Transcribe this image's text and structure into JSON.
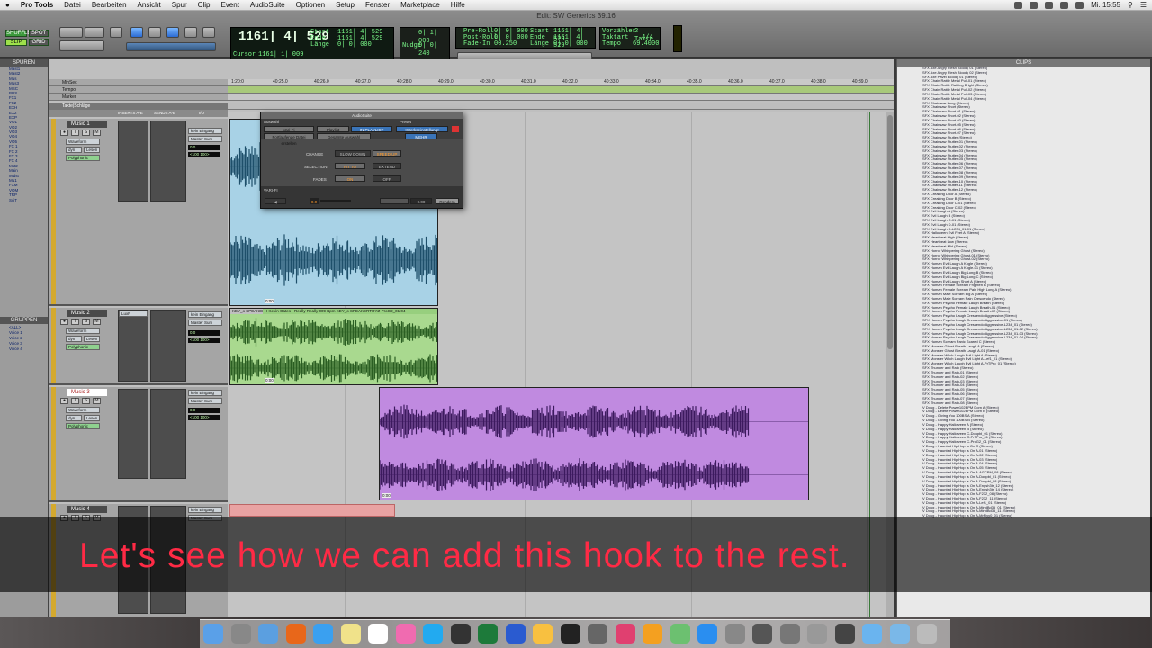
{
  "menubar": {
    "app": "Pro Tools",
    "items": [
      "Datei",
      "Bearbeiten",
      "Ansicht",
      "Spur",
      "Clip",
      "Event",
      "AudioSuite",
      "Optionen",
      "Setup",
      "Fenster",
      "Marketplace",
      "Hilfe"
    ],
    "clock": "Mi. 15:55"
  },
  "window_title": "Edit: SW Generics 39.16",
  "transport": {
    "counter_main": "1161| 4| 529",
    "start_label": "Start",
    "end_label": "Ende",
    "length_label": "Länge",
    "start_val": "1161| 4| 529",
    "end_val": "1161| 4| 529",
    "length_val": "0| 0| 000",
    "cursor_label": "Cursor",
    "cursor_val": "1161| 1| 009",
    "nudge_label": "Nudge",
    "nudge_val": "0| 0| 240",
    "grid_val": "0| 1| 000",
    "preroll_label": "Pre-Roll",
    "postroll_label": "Post-Roll",
    "fadein_label": "Fade-In",
    "preroll_val": "0| 0| 000",
    "postroll_val": "0| 0| 000",
    "fadein_val": "00.250",
    "start2_val": "1161| 4| 529",
    "end2_val": "1161| 4| 529",
    "length2_val": "0| 0| 000",
    "tempo_label": "Tempo",
    "tempo_val": "69.4000",
    "meter_label": "Taktart",
    "meter_val": "4/4",
    "countoff_label": "Vorzähler",
    "countoff_val": "2 Takte",
    "mode_a": "SHUFFLE",
    "mode_b": "SLIP",
    "mode_c": "SPOT",
    "mode_d": "GRID"
  },
  "tracklist": {
    "header": "SPUREN",
    "items": [
      "Mast1",
      "Mast2",
      "Mus",
      "Mus3",
      "MSC",
      "BUS",
      "FX1",
      "FX2",
      "EXH",
      "EX2",
      "EXP",
      "VO1",
      "VO2",
      "VO3",
      "VO4",
      "VO5",
      "FX 1",
      "FX 2",
      "FX 3",
      "FX 4",
      "Mst2",
      "Main",
      "Midst",
      "Mu1",
      "FXM",
      "VOM",
      "TRP",
      "SciT"
    ],
    "groups_header": "GRUPPEN",
    "groups": [
      "<ALL>",
      "Voice 1",
      "Voice 2",
      "Voice 3",
      "Voice 4"
    ]
  },
  "rulers": {
    "minsec": "MinSec",
    "tempo": "Tempo",
    "marker": "Marker",
    "tracks": "Takte|Schläge",
    "ticks": [
      "1:20:0",
      "40:25.0",
      "40:26.0",
      "40:27.0",
      "40:28.0",
      "40:29.0",
      "40:30.0",
      "40:31.0",
      "40:32.0",
      "40:33.0",
      "40:34.0",
      "40:35.0",
      "40:36.0",
      "40:37.0",
      "40:38.0",
      "40:39.0"
    ]
  },
  "columns": {
    "inserts": "INSERTS A-E",
    "sends": "SENDS A-E",
    "io": "I/O"
  },
  "tracks": [
    {
      "name": "Music 1",
      "input": "kein Eingang",
      "output": "Master Sum",
      "vol": "0.0",
      "pan": "<100  100>",
      "mode": "Waveform",
      "view": "Lesen",
      "extra": "Polyphonic",
      "insert": ""
    },
    {
      "name": "Music 2",
      "input": "kein Eingang",
      "output": "Master Sum",
      "vol": "0.0",
      "pan": "<100  100>",
      "mode": "Waveform",
      "view": "Lesen",
      "extra": "Polyphonic",
      "insert": "LuxF"
    },
    {
      "name": "Music 3",
      "input": "kein Eingang",
      "output": "Master Sum",
      "vol": "0.0",
      "pan": "<100  100>",
      "mode": "Waveform",
      "view": "Lesen",
      "extra": "Polyphonic",
      "insert": ""
    },
    {
      "name": "Music 4",
      "input": "kein Eingang",
      "output": "Master Sum",
      "vol": "0.0",
      "pan": "<100  100>",
      "mode": "Waveform",
      "view": "Lesen",
      "extra": "Polyphonic",
      "insert": ""
    }
  ],
  "clips": {
    "c1_name": "KEY_o SPEAKER",
    "c1_fade": "0:00",
    "c2a_name": "KEY_o SPEAKER",
    "c2b_name": "H Kevin Gates - Really Really 009 Bpm KEY_o SPEAKERTOYZ-ProG2_01.04",
    "c2_fade": "0:00",
    "c3_name": "H Yo Gotti feat. Blac Youngsta - Wait For It 066bpm KEY_o SPEAKERTOYZ-G2",
    "c3_fade": "0:00"
  },
  "plugin": {
    "title": "AudioSuite",
    "selection_label": "Auswahl",
    "preset_label": "Preset",
    "plugin_name": "Vari-Fi",
    "playlist_btn": "Playlist",
    "use_in_playlist": "IN PLAYLIST",
    "preset_val": "<Werkseinstellung>",
    "mode_btn": "Fortlaufende Datei erstellen",
    "whole_btn": "Gesamte Auswahl",
    "more_btn": "MEHR",
    "change_label": "CHANGE",
    "slow_down": "SLOW DOWN",
    "speed_up": "SPEED UP",
    "selection_row": "SELECTION",
    "fit_to": "FIT TO",
    "extend": "EXTEND",
    "fades_label": "FADES",
    "on": "ON",
    "off": "OFF",
    "section": "VARI-FI",
    "value_a": "0.0",
    "value_b": "0.00",
    "render_btn": "Rendern"
  },
  "clipslist": {
    "header": "CLIPS",
    "items": [
      "SFX Axe Angry Flesh Bloody 01 (Stereo)",
      "SFX Axe Angry Flesh Bloody 02 (Stereo)",
      "SFX Axe Pavel Bloody 01 (Stereo)",
      "SFX Chain Rattle Metal Pull-01 (Stereo)",
      "SFX Chain Rattle Rattling Bright (Stereo)",
      "SFX Chain Rattle Metal Pull-02 (Stereo)",
      "SFX Chain Rattle Metal Pull-03 (Stereo)",
      "SFX Chain Rattle Metal Pull-04 (Stereo)",
      "SFX Chainsaw Long (Stereo)",
      "SFX Chainsaw Short (Stereo)",
      "SFX Chainsaw Short-01 (Stereo)",
      "SFX Chainsaw Short-02 (Stereo)",
      "SFX Chainsaw Short-03 (Stereo)",
      "SFX Chainsaw Short-05 (Stereo)",
      "SFX Chainsaw Short-06 (Stereo)",
      "SFX Chainsaw Short-07 (Stereo)",
      "SFX Chainsaw Stutter (Stereo)",
      "SFX Chainsaw Stutter-01 (Stereo)",
      "SFX Chainsaw Stutter-02 (Stereo)",
      "SFX Chainsaw Stutter-03 (Stereo)",
      "SFX Chainsaw Stutter-04 (Stereo)",
      "SFX Chainsaw Stutter-05 (Stereo)",
      "SFX Chainsaw Stutter-06 (Stereo)",
      "SFX Chainsaw Stutter-07 (Stereo)",
      "SFX Chainsaw Stutter-08 (Stereo)",
      "SFX Chainsaw Stutter-09 (Stereo)",
      "SFX Chainsaw Stutter-10 (Stereo)",
      "SFX Chainsaw Stutter-11 (Stereo)",
      "SFX Chainsaw Stutter-12 (Stereo)",
      "SFX Creaking Door A (Stereo)",
      "SFX Creaking Door B (Stereo)",
      "SFX Creaking Door C-01 (Stereo)",
      "SFX Creaking Door C-02 (Stereo)",
      "SFX Evil Laugh A (Stereo)",
      "SFX Evil Laugh B (Stereo)",
      "SFX Evil Laugh C-01 (Stereo)",
      "SFX Evil Laugh D-01 (Stereo)",
      "SFX Evil Laugh D-L234_01-01 (Stereo)",
      "SFX Halloween Evil Feet A (Stereo)",
      "SFX Heartbeat High (Stereo)",
      "SFX Heartbeat Low (Stereo)",
      "SFX Heartbeat Mid (Stereo)",
      "SFX Horror Whispering Ghost (Stereo)",
      "SFX Horror Whispering Ghost-01 (Stereo)",
      "SFX Horror Whispering Ghost-02 (Stereo)",
      "SFX Human Evil Laugh A Kogle (Stereo)",
      "SFX Human Evil Laugh A Kogle-01 (Stereo)",
      "SFX Human Evil Laugh Big Long B (Stereo)",
      "SFX Human Evil Laugh Big Long C (Stereo)",
      "SFX Human Evil Laugh Short A (Stereo)",
      "SFX Human Female Scream Frighten B (Stereo)",
      "SFX Human Female Scream Pain High Long A (Stereo)",
      "SFX Human Male Scream Big A (Stereo)",
      "SFX Human Male Scream Pain Crescendo (Stereo)",
      "SFX Human Psycho Female Laugh Breath (Stereo)",
      "SFX Human Psycho Female Laugh Breath-01 (Stereo)",
      "SFX Human Psycho Female Laugh Breath-02 (Stereo)",
      "SFX Human Psycho Laugh Crescendo Aggressive (Stereo)",
      "SFX Human Psycho Laugh Crescendo Aggressive-01 (Stereo)",
      "SFX Human Psycho Laugh Crescendo Aggressive-L234_01 (Stereo)",
      "SFX Human Psycho Laugh Crescendo Aggressive-L234_01-02 (Stereo)",
      "SFX Human Psycho Laugh Crescendo Aggressive-L234_01-03 (Stereo)",
      "SFX Human Psycho Laugh Crescendo Aggressive-L234_01-04 (Stereo)",
      "SFX Human Scream Panic Scared C (Stereo)",
      "SFX Monster Ghost Breath Laugh A (Stereo)",
      "SFX Monster Ghost Breath Laugh A-01 (Stereo)",
      "SFX Monster Witch Laugh Evil Light A (Stereo)",
      "SFX Monster Witch Laugh Evil Light A-Lef1_01 (Stereo)",
      "SFX Monster Witch Laugh Evil Light A-PrTPro_01 (Stereo)",
      "SFX Thunder and Rain (Stereo)",
      "SFX Thunder and Rain-01 (Stereo)",
      "SFX Thunder and Rain-02 (Stereo)",
      "SFX Thunder and Rain-03 (Stereo)",
      "SFX Thunder and Rain-04 (Stereo)",
      "SFX Thunder and Rain-05 (Stereo)",
      "SFX Thunder and Rain-06 (Stereo)",
      "SFX Thunder and Rain-07 (Stereo)",
      "SFX Thunder and Rain-08 (Stereo)",
      "V Doug - Delete Power102BPM Dorn A (Stereo)",
      "V Doug - Delete Power102BPM Dorn B (Stereo)",
      "V Doug - Giving You 100BS A (Stereo)",
      "V Doug - Giving You 100BS B (Stereo)",
      "V Doug - Happy Halloween A (Stereo)",
      "V Doug - Happy Halloween B (Stereo)",
      "V Doug - Happy Halloween C-Doupbl_01 (Stereo)",
      "V Doug - Happy Halloween C-PrTPro_01 (Stereo)",
      "V Doug - Happy Halloween C-ProG2_01 (Stereo)",
      "V Doug - Haunted Hip Hop Is On C (Stereo)",
      "V Doug - Haunted Hip Hop Is On A-01 (Stereo)",
      "V Doug - Haunted Hip Hop Is On A-02 (Stereo)",
      "V Doug - Haunted Hip Hop Is On A-03 (Stereo)",
      "V Doug - Haunted Hip Hop Is On A-04 (Stereo)",
      "V Doug - Haunted Hip Hop Is On A-05 (Stereo)",
      "V Doug - Haunted Hip Hop Is On A-AGCPM_08 (Stereo)",
      "V Doug - Haunted Hip Hop Is On A-Doupbl_01 (Stereo)",
      "V Doug - Haunted Hip Hop Is On A-Doupbl_08 (Stereo)",
      "V Doug - Haunted Hip Hop Is On A-Engsh3tr_12 (Stereo)",
      "V Doug - Haunted Hip Hop Is On A-Engsh3tr_14 (Stereo)",
      "V Doug - Haunted Hip Hop Is On A-F232_08 (Stereo)",
      "V Doug - Haunted Hip Hop Is On A-F232_11 (Stereo)",
      "V Doug - Haunted Hip Hop Is On A-Lef1_01 (Stereo)",
      "V Doug - Haunted Hip Hop Is On A-MindBd35_01 (Stereo)",
      "V Doug - Haunted Hip Hop Is On A-MindBd35_11 (Stereo)",
      "V Doug - Haunted Hip Hop Is On A-MrFlyy0_01 (Stereo)"
    ]
  },
  "subtitle": "Let's see how we can add this hook to the rest.",
  "colors": {
    "track1": "#a8d2e6",
    "track2": "#a9d98f",
    "track3": "#c08ae0",
    "track4": "#e9a3a3",
    "subtitle": "#ff2a45"
  },
  "dock": {
    "icons": [
      "finder-icon",
      "launchpad-icon",
      "mail-icon",
      "firefox-icon",
      "safari-icon",
      "notes-icon",
      "calendar-icon",
      "itunes-icon",
      "skype-icon",
      "protools-icon",
      "excel-icon",
      "word-icon",
      "photos-icon",
      "terminal-icon",
      "video-icon",
      "music-icon",
      "books-icon",
      "maps-icon",
      "appstore-icon",
      "settings-icon",
      "logic-icon",
      "scripts-icon",
      "audio-icon",
      "quicktime-icon",
      "downloads-icon",
      "documents-icon",
      "trash-icon"
    ]
  }
}
